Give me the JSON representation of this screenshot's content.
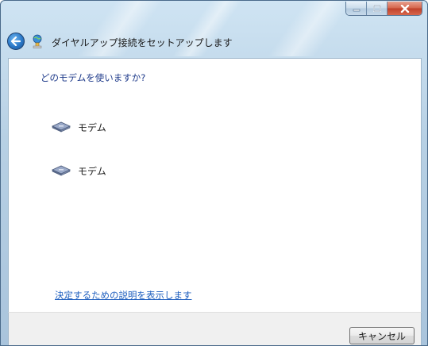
{
  "window": {
    "title": "ダイヤルアップ接続をセットアップします",
    "caption_buttons": [
      "minimize-icon",
      "maximize-icon",
      "close-icon"
    ]
  },
  "content": {
    "question": "どのモデムを使いますか?",
    "modems": [
      {
        "label": "モデム",
        "icon": "modem-icon"
      },
      {
        "label": "モデム",
        "icon": "modem-icon"
      }
    ],
    "help_link": "決定するための説明を表示します"
  },
  "footer": {
    "cancel_label": "キャンセル"
  },
  "colors": {
    "frame": "#b7d0e4",
    "close_button": "#c0402a",
    "link": "#1f5fbf",
    "question_text": "#1e3a8a"
  }
}
